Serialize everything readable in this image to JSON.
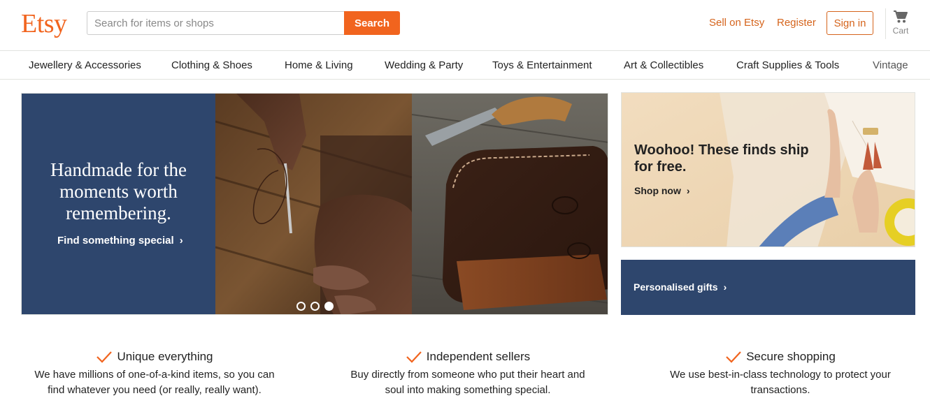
{
  "header": {
    "logo": "Etsy",
    "search_placeholder": "Search for items or shops",
    "search_button": "Search",
    "sell_link": "Sell on Etsy",
    "register_link": "Register",
    "signin_button": "Sign in",
    "cart_label": "Cart"
  },
  "categories": [
    "Jewellery & Accessories",
    "Clothing & Shoes",
    "Home & Living",
    "Wedding & Party",
    "Toys & Entertainment",
    "Art & Collectibles",
    "Craft Supplies & Tools",
    "Vintage"
  ],
  "hero": {
    "title": "Handmade for the moments worth remembering.",
    "link": "Find something special",
    "slides": 3,
    "active_slide": 3
  },
  "promo": {
    "title": "Woohoo! These finds ship for free.",
    "link": "Shop now"
  },
  "gifts": {
    "label": "Personalised gifts"
  },
  "value_props": [
    {
      "title": "Unique everything",
      "desc": "We have millions of one-of-a-kind items, so you can find whatever you need (or really, really want)."
    },
    {
      "title": "Independent sellers",
      "desc": "Buy directly from someone who put their heart and soul into making something special."
    },
    {
      "title": "Secure shopping",
      "desc": "We use best-in-class technology to protect your transactions."
    }
  ],
  "colors": {
    "brand_orange": "#f1641e",
    "link_orange": "#d5641c",
    "navy": "#2e466d"
  }
}
